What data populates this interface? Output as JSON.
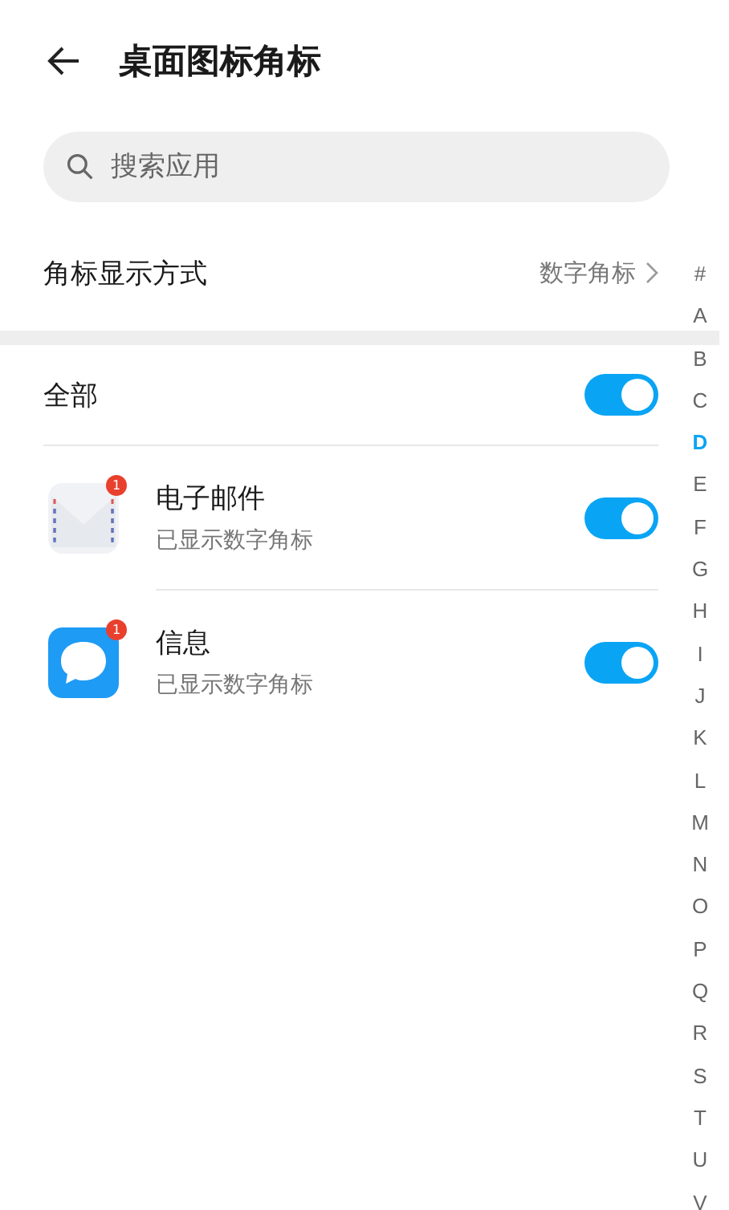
{
  "header": {
    "title": "桌面图标角标"
  },
  "search": {
    "placeholder": "搜索应用"
  },
  "badge_mode": {
    "label": "角标显示方式",
    "value": "数字角标"
  },
  "all": {
    "label": "全部",
    "on": true
  },
  "apps": [
    {
      "kind": "mail",
      "name": "电子邮件",
      "status": "已显示数字角标",
      "badge": "1",
      "on": true
    },
    {
      "kind": "message",
      "name": "信息",
      "status": "已显示数字角标",
      "badge": "1",
      "on": true
    }
  ],
  "index": [
    {
      "letter": "#",
      "selected": false
    },
    {
      "letter": "A",
      "selected": false
    },
    {
      "letter": "B",
      "selected": false
    },
    {
      "letter": "C",
      "selected": false
    },
    {
      "letter": "D",
      "selected": true
    },
    {
      "letter": "E",
      "selected": false
    },
    {
      "letter": "F",
      "selected": false
    },
    {
      "letter": "G",
      "selected": false
    },
    {
      "letter": "H",
      "selected": false
    },
    {
      "letter": "I",
      "selected": false
    },
    {
      "letter": "J",
      "selected": false
    },
    {
      "letter": "K",
      "selected": false
    },
    {
      "letter": "L",
      "selected": false
    },
    {
      "letter": "M",
      "selected": false
    },
    {
      "letter": "N",
      "selected": false
    },
    {
      "letter": "O",
      "selected": false
    },
    {
      "letter": "P",
      "selected": false
    },
    {
      "letter": "Q",
      "selected": false
    },
    {
      "letter": "R",
      "selected": false
    },
    {
      "letter": "S",
      "selected": false
    },
    {
      "letter": "T",
      "selected": false
    },
    {
      "letter": "U",
      "selected": false
    },
    {
      "letter": "V",
      "selected": false
    }
  ]
}
